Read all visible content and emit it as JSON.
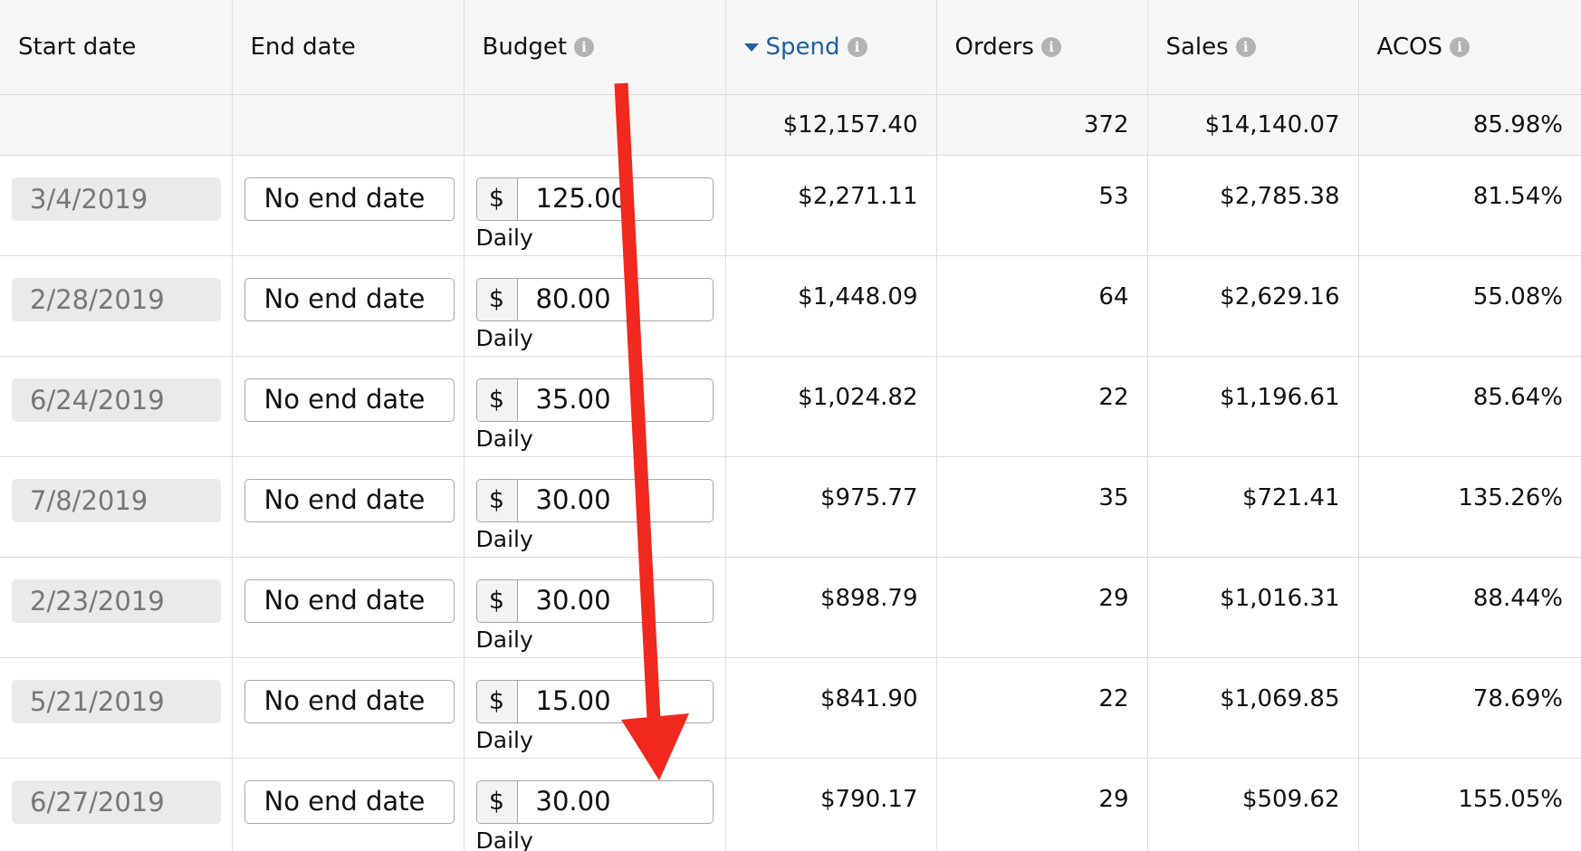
{
  "columns": [
    {
      "label": "Start date",
      "info": false,
      "sorted": false
    },
    {
      "label": "End date",
      "info": false,
      "sorted": false
    },
    {
      "label": "Budget",
      "info": true,
      "sorted": false
    },
    {
      "label": "Spend",
      "info": true,
      "sorted": true
    },
    {
      "label": "Orders",
      "info": true,
      "sorted": false
    },
    {
      "label": "Sales",
      "info": true,
      "sorted": false
    },
    {
      "label": "ACOS",
      "info": true,
      "sorted": false
    }
  ],
  "info_glyph": "i",
  "totals": {
    "spend": "$12,157.40",
    "orders": "372",
    "sales": "$14,140.07",
    "acos": "85.98%"
  },
  "rows": [
    {
      "start": "3/4/2019",
      "end": "No end date",
      "currency": "$",
      "budget": "125.00",
      "period": "Daily",
      "spend": "$2,271.11",
      "orders": "53",
      "sales": "$2,785.38",
      "acos": "81.54%"
    },
    {
      "start": "2/28/2019",
      "end": "No end date",
      "currency": "$",
      "budget": "80.00",
      "period": "Daily",
      "spend": "$1,448.09",
      "orders": "64",
      "sales": "$2,629.16",
      "acos": "55.08%"
    },
    {
      "start": "6/24/2019",
      "end": "No end date",
      "currency": "$",
      "budget": "35.00",
      "period": "Daily",
      "spend": "$1,024.82",
      "orders": "22",
      "sales": "$1,196.61",
      "acos": "85.64%"
    },
    {
      "start": "7/8/2019",
      "end": "No end date",
      "currency": "$",
      "budget": "30.00",
      "period": "Daily",
      "spend": "$975.77",
      "orders": "35",
      "sales": "$721.41",
      "acos": "135.26%"
    },
    {
      "start": "2/23/2019",
      "end": "No end date",
      "currency": "$",
      "budget": "30.00",
      "period": "Daily",
      "spend": "$898.79",
      "orders": "29",
      "sales": "$1,016.31",
      "acos": "88.44%"
    },
    {
      "start": "5/21/2019",
      "end": "No end date",
      "currency": "$",
      "budget": "15.00",
      "period": "Daily",
      "spend": "$841.90",
      "orders": "22",
      "sales": "$1,069.85",
      "acos": "78.69%"
    },
    {
      "start": "6/27/2019",
      "end": "No end date",
      "currency": "$",
      "budget": "30.00",
      "period": "Daily",
      "spend": "$790.17",
      "orders": "29",
      "sales": "$509.62",
      "acos": "155.05%"
    }
  ],
  "colors": {
    "accent": "#1f5f9f",
    "arrow": "#f0281e",
    "header_bg": "#f6f6f6",
    "disabled_field": "#eaeaea"
  },
  "annotation": {
    "type": "arrow-down",
    "color": "#f0281e"
  }
}
